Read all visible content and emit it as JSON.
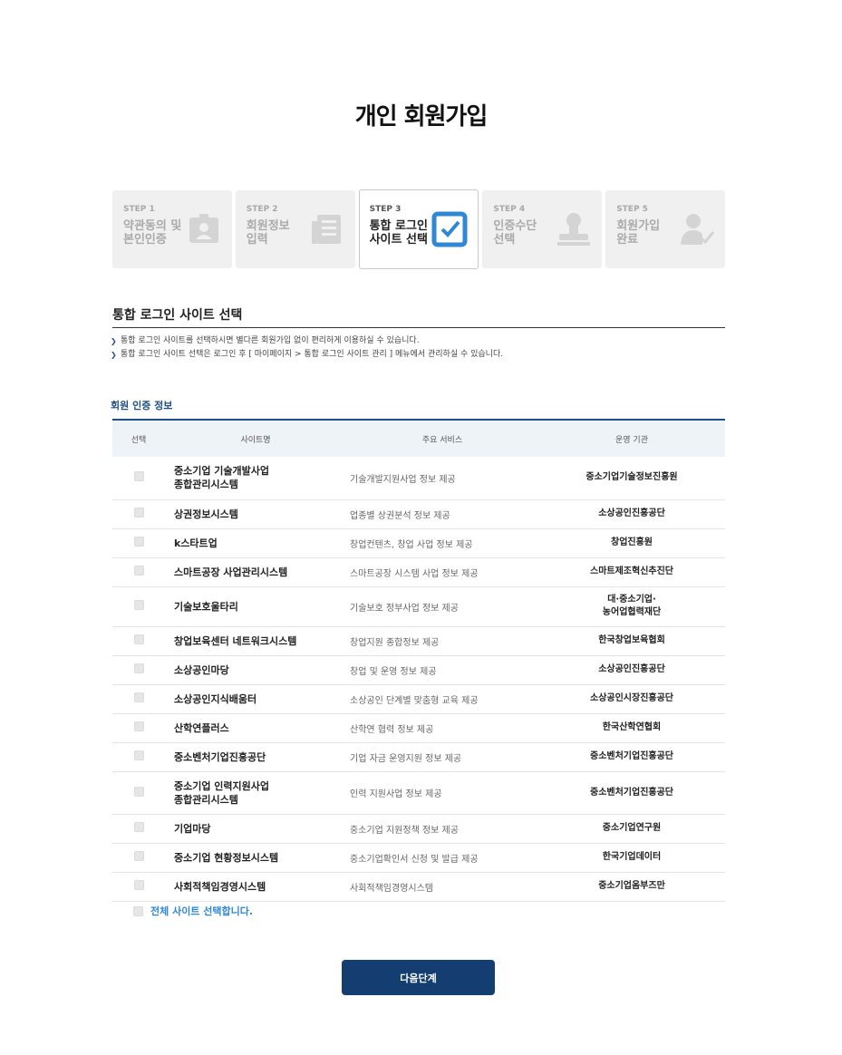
{
  "page": {
    "title": "개인 회원가입"
  },
  "steps": [
    {
      "no": "STEP 1",
      "name": "약관동의 및\n본인인증",
      "icon": "id-card-icon",
      "active": false
    },
    {
      "no": "STEP 2",
      "name": "회원정보\n입력",
      "icon": "document-list-icon",
      "active": false
    },
    {
      "no": "STEP 3",
      "name": "통합 로그인\n사이트 선택",
      "icon": "checkbox-check-icon",
      "active": true
    },
    {
      "no": "STEP 4",
      "name": "인증수단\n선택",
      "icon": "stamp-icon",
      "active": false
    },
    {
      "no": "STEP 5",
      "name": "회원가입\n완료",
      "icon": "user-check-icon",
      "active": false
    }
  ],
  "section": {
    "title": "통합 로그인 사이트 선택",
    "notes": [
      "통합 로그인 사이트를 선택하시면 별다른 회원가입 없이 편리하게 이용하실 수 있습니다.",
      "통합 로그인 사이트 선택은 로그인 후 [ 마이페이지 > 통합 로그인 사이트 관리 ] 메뉴에서 관리하실 수 있습니다."
    ]
  },
  "table": {
    "caption": "회원 인증 정보",
    "headers": {
      "select": "선택",
      "site": "사이트명",
      "service": "주요 서비스",
      "org": "운영 기관"
    },
    "rows": [
      {
        "site": "중소기업 기술개발사업\n종합관리시스템",
        "service": "기술개발지원사업 정보 제공",
        "org": "중소기업기술정보진흥원"
      },
      {
        "site": "상권정보시스템",
        "service": "업종별 상권분석 정보 제공",
        "org": "소상공인진흥공단"
      },
      {
        "site": "k스타트업",
        "service": "창업컨텐츠, 창업 사업 정보 제공",
        "org": "창업진흥원"
      },
      {
        "site": "스마트공장 사업관리시스템",
        "service": "스마트공장 시스템 사업 정보 제공",
        "org": "스마트제조혁신추진단"
      },
      {
        "site": "기술보호울타리",
        "service": "기술보호 정부사업 정보 제공",
        "org": "대·중소기업·\n농어업협력재단"
      },
      {
        "site": "창업보육센터 네트워크시스템",
        "service": "창업지원 종합정보 제공",
        "org": "한국창업보육협회"
      },
      {
        "site": "소상공인마당",
        "service": "창업 및 운영 정보 제공",
        "org": "소상공인진흥공단"
      },
      {
        "site": "소상공인지식배움터",
        "service": "소상공인 단계별 맞춤형 교육 제공",
        "org": "소상공인시장진흥공단"
      },
      {
        "site": "산학연플러스",
        "service": "산학연 협력 정보 제공",
        "org": "한국산학연협회"
      },
      {
        "site": "중소벤처기업진흥공단",
        "service": "기업 자금 운영지원 정보 제공",
        "org": "중소벤처기업진흥공단"
      },
      {
        "site": "중소기업 인력지원사업\n종합관리시스템",
        "service": "인력 지원사업 정보 제공",
        "org": "중소벤처기업진흥공단"
      },
      {
        "site": "기업마당",
        "service": "중소기업 지원정책 정보 제공",
        "org": "중소기업연구원"
      },
      {
        "site": "중소기업 현황정보시스템",
        "service": "중소기업확인서 신청 및 발급 제공",
        "org": "한국기업데이터"
      },
      {
        "site": "사회적책임경영시스템",
        "service": "사회적책임경영시스템",
        "org": "중소기업옴부즈만"
      }
    ]
  },
  "select_all": {
    "label": "전체 사이트 선택합니다."
  },
  "next_button": {
    "label": "다음단계"
  },
  "colors": {
    "primary": "#143e71",
    "accent": "#1d4f86",
    "link": "#2f88d6"
  }
}
